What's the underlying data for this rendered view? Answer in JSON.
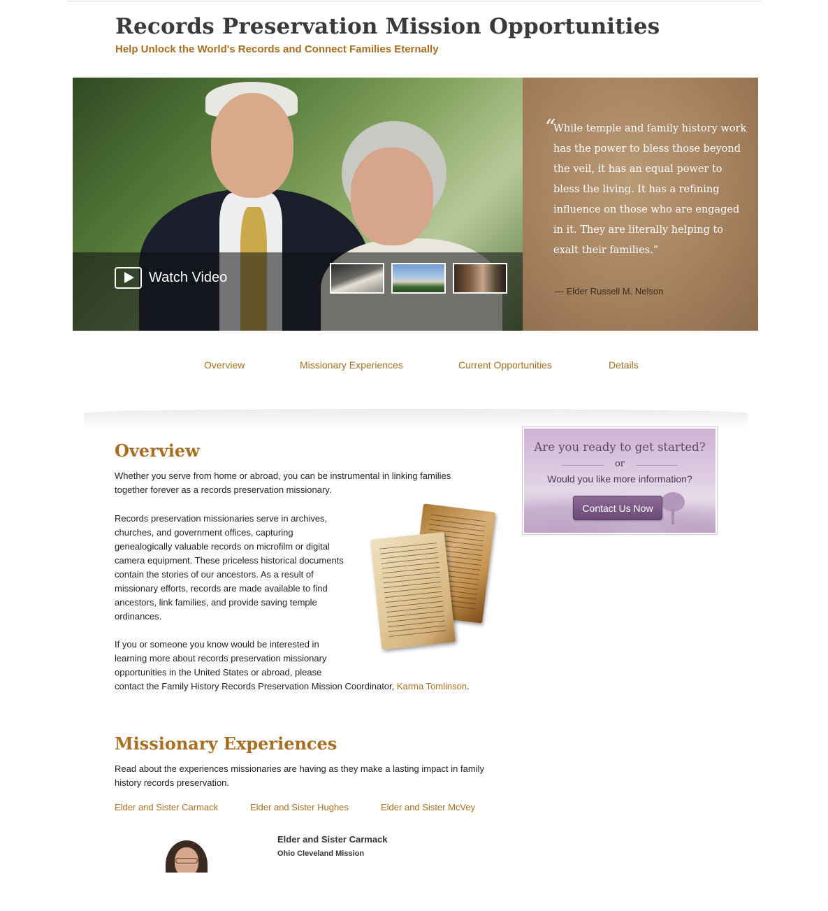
{
  "header": {
    "title": "Records Preservation Mission Opportunities",
    "subtitle": "Help Unlock the World's Records and Connect Families Eternally"
  },
  "hero": {
    "watch_video_label": "Watch Video",
    "thumbnails": [
      "video-thumbnail-1",
      "video-thumbnail-2",
      "video-thumbnail-3"
    ],
    "quote_mark": "“",
    "quote": "While temple and family history work has the power to bless those beyond the veil, it has an equal power to bless the living. It has a refining influence on those who are engaged in it. They are literally helping to exalt their families.”",
    "quote_author": "— Elder Russell M. Nelson"
  },
  "nav": {
    "items": [
      {
        "label": "Overview"
      },
      {
        "label": "Missionary Experiences"
      },
      {
        "label": "Current Opportunities"
      },
      {
        "label": "Details"
      }
    ]
  },
  "overview": {
    "title": "Overview",
    "para1": "Whether you serve from home or abroad, you can be instrumental in linking families together forever as a records preservation missionary.",
    "para2": "Records preservation missionaries serve in archives, churches, and government offices, capturing genealogically valuable records on microfilm or digital camera equipment. These priceless historical documents contain the stories of our ancestors. As a result of missionary efforts, records are made available to find ancestors, link families, and provide saving temple ordinances.",
    "para3_line1": "If you or someone you know would be interested in",
    "para3_line2": "learning more about records preservation missionary",
    "para3_line3": "opportunities in the United States or abroad, please",
    "para3_line4": "contact the Family History Records Preservation Mission Coordinator, ",
    "contact_link": "Karma Tomlinson",
    "para3_end": "."
  },
  "cta": {
    "title": "Are you ready to get started?",
    "or": "or",
    "subtitle": "Would you like more information?",
    "button": "Contact Us Now"
  },
  "missionary_experiences": {
    "title": "Missionary Experiences",
    "intro": "Read about the experiences missionaries are having as they make a lasting impact in family history records preservation.",
    "links": [
      {
        "label": "Elder and Sister Carmack"
      },
      {
        "label": "Elder and Sister Hughes"
      },
      {
        "label": "Elder and Sister McVey"
      }
    ],
    "featured": {
      "name": "Elder and Sister Carmack",
      "mission": "Ohio Cleveland Mission"
    }
  },
  "colors": {
    "accent": "#a86f22",
    "quote_panel": "#a27f5d",
    "cta_purple": "#6a4a74"
  }
}
